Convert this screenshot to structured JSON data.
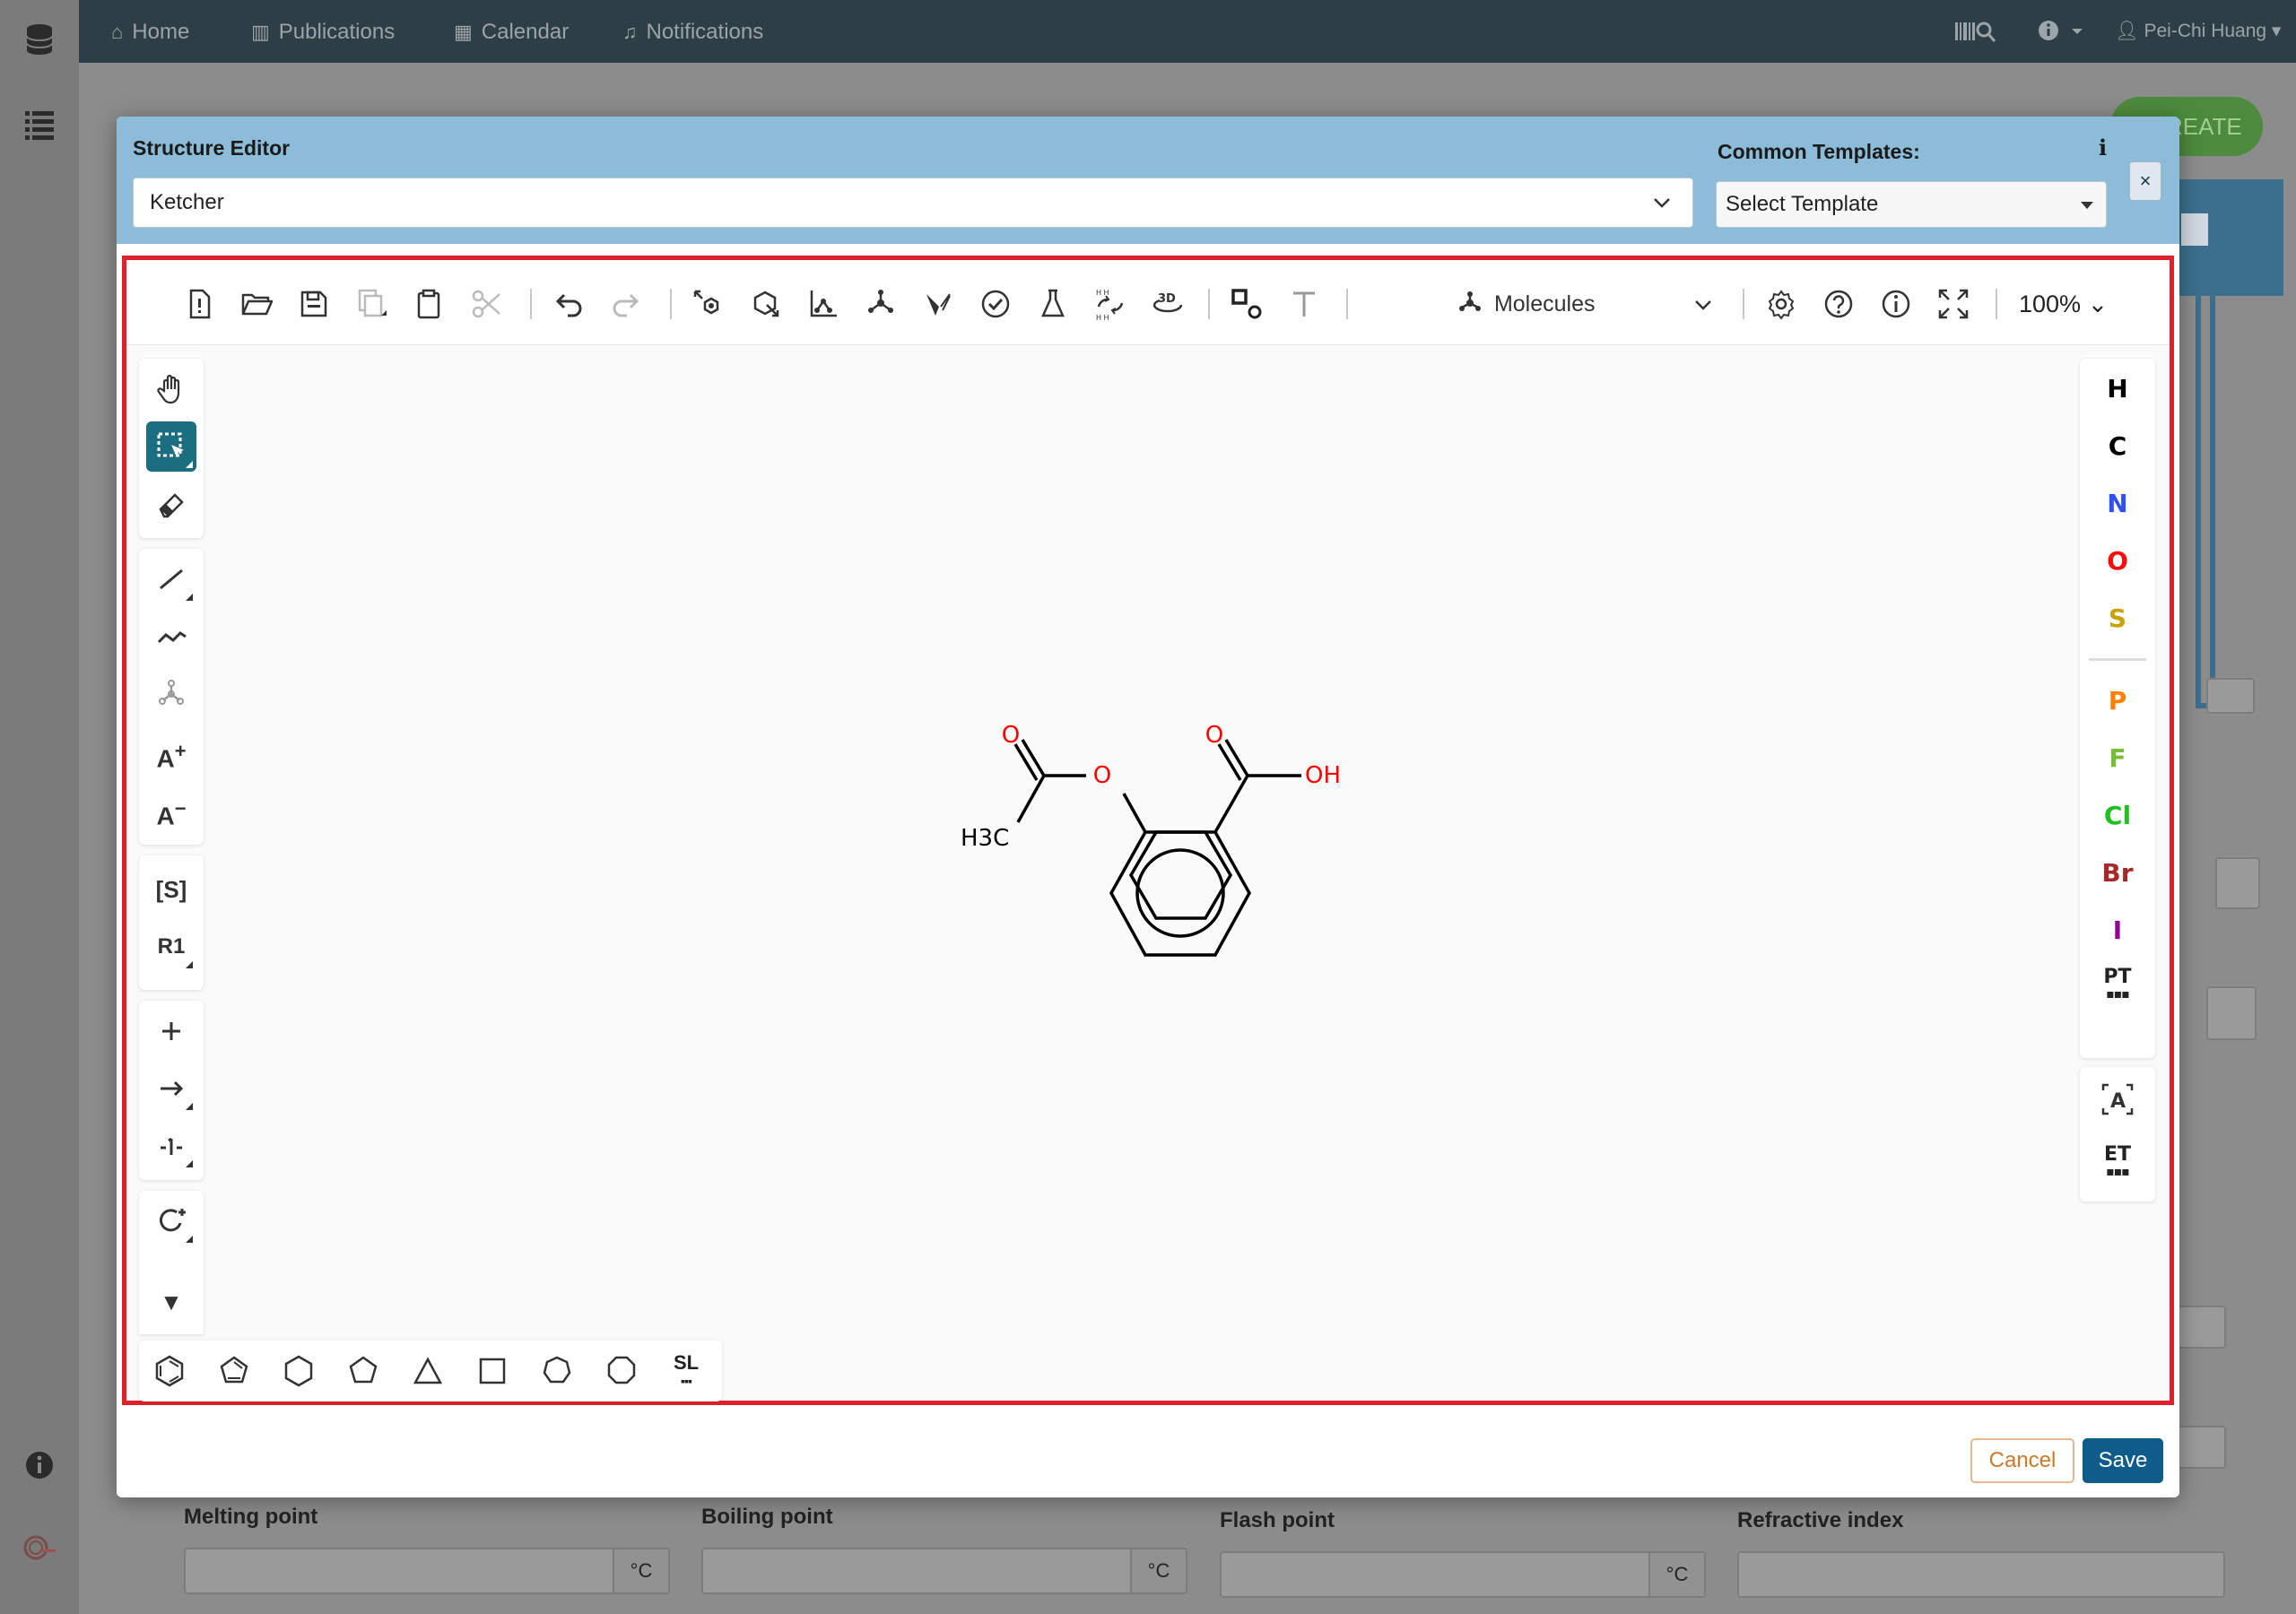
{
  "topnav": {
    "items": [
      {
        "label": "Home",
        "icon": "home-icon"
      },
      {
        "label": "Publications",
        "icon": "book-icon"
      },
      {
        "label": "Calendar",
        "icon": "calendar-icon"
      },
      {
        "label": "Notifications",
        "icon": "bell-icon"
      }
    ],
    "user_name": "Pei-Chi Huang"
  },
  "background": {
    "create_button": "REATE",
    "fields": [
      {
        "label": "Melting point",
        "unit": "°C"
      },
      {
        "label": "Boiling point",
        "unit": "°C"
      },
      {
        "label": "Flash point",
        "unit": "°C"
      },
      {
        "label": "Refractive index",
        "unit": ""
      }
    ]
  },
  "modal": {
    "title": "Structure Editor",
    "editor_value": "Ketcher",
    "templates_label": "Common Templates:",
    "template_placeholder": "Select Template",
    "info_label": "i",
    "close_label": "×",
    "cancel_label": "Cancel",
    "save_label": "Save"
  },
  "ketcher": {
    "mode_label": "Molecules",
    "zoom_label": "100%",
    "atoms": [
      {
        "symbol": "H",
        "color": "#000000"
      },
      {
        "symbol": "C",
        "color": "#000000"
      },
      {
        "symbol": "N",
        "color": "#304ff7"
      },
      {
        "symbol": "O",
        "color": "#ff0d0d"
      },
      {
        "symbol": "S",
        "color": "#c9a20a"
      },
      {
        "symbol": "P",
        "color": "#ff8000"
      },
      {
        "symbol": "F",
        "color": "#78be39"
      },
      {
        "symbol": "Cl",
        "color": "#1fc01f"
      },
      {
        "symbol": "Br",
        "color": "#a62929"
      },
      {
        "symbol": "I",
        "color": "#940094"
      }
    ],
    "periodic_table_label": "PT",
    "extended_table_label": "ET",
    "structure_library_label": "SL",
    "text_tools": {
      "atom_plus": "A",
      "atom_minus": "A",
      "sgroup": "[S]",
      "rgroup": "R1"
    },
    "molecule": {
      "name": "acetylsalicylic acid",
      "labels": {
        "o1": "O",
        "o2": "O",
        "o3": "O",
        "oh": "OH",
        "ch3": "H3C"
      }
    }
  }
}
